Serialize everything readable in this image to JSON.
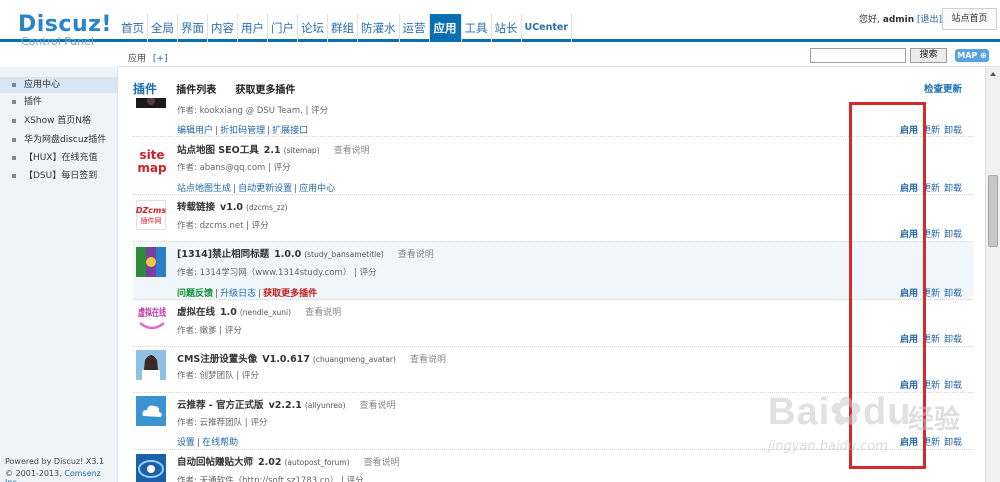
{
  "header": {
    "logo_brand": "Discuz!",
    "logo_sub": "Control Panel",
    "nav": [
      {
        "label": "首页"
      },
      {
        "label": "全局"
      },
      {
        "label": "界面"
      },
      {
        "label": "内容"
      },
      {
        "label": "用户"
      },
      {
        "label": "门户"
      },
      {
        "label": "论坛"
      },
      {
        "label": "群组"
      },
      {
        "label": "防灌水"
      },
      {
        "label": "运营"
      },
      {
        "label": "应用"
      },
      {
        "label": "工具"
      },
      {
        "label": "站长"
      },
      {
        "label": "UCenter"
      }
    ],
    "greeting": "您好,",
    "username": "admin",
    "logout": "[退出]",
    "site_home": "站点首页"
  },
  "subbar": {
    "crumb": "应用",
    "crumb_plus": "[+]",
    "search_value": "",
    "search_button": "搜索",
    "map_button": "MAP"
  },
  "sidebar": {
    "items": [
      {
        "label": "应用中心"
      },
      {
        "label": "插件"
      },
      {
        "label": "XShow 首页N格"
      },
      {
        "label": "华为网盘discuz插件"
      },
      {
        "label": "【HUX】在线充值"
      },
      {
        "label": "【DSU】每日签到"
      }
    ],
    "footer_powered": "Powered by",
    "footer_product": "Discuz! X3.1",
    "footer_copy": "© 2001-2013,",
    "footer_company": "Comsenz Inc."
  },
  "main": {
    "tab_title": "插件",
    "tab_list": "插件列表",
    "tab_more": "获取更多插件",
    "check_update": "检查更新",
    "actions": {
      "enable": "启用",
      "update": "更新",
      "uninstall": "卸载"
    },
    "plugins": [
      {
        "author": "作者: kookxiang @ DSU Team. | 评分",
        "links": [
          "编辑用户",
          "折扣码管理",
          "扩展接口"
        ]
      },
      {
        "name": "站点地图 SEO工具",
        "version": "2.1",
        "id": "(sitemap)",
        "doc": "查看说明",
        "author": "作者: abans@qq.com | 评分",
        "links": [
          "站点地图生成",
          "自动更新设置",
          "应用中心"
        ]
      },
      {
        "name": "转载链接",
        "version": "v1.0",
        "id": "(dzcms_zz)",
        "doc": "",
        "author": "作者: dzcms.net | 评分",
        "links": []
      },
      {
        "name": "[1314]禁止相同标题",
        "version": "1.0.0",
        "id": "(study_bansametitle)",
        "doc": "查看说明",
        "author": "作者: 1314学习网（www.1314study.com） | 评分",
        "links": [
          "问题反馈",
          "升级日志",
          "获取更多插件"
        ]
      },
      {
        "name": "虚拟在线",
        "version": "1.0",
        "id": "(nendie_xuni)",
        "doc": "查看说明",
        "author": "作者: 嫩爹 | 评分",
        "links": []
      },
      {
        "name": "CMS注册设置头像",
        "version": "V1.0.617",
        "id": "(chuangmeng_avatar)",
        "doc": "查看说明",
        "author": "作者: 创梦团队 | 评分",
        "links": []
      },
      {
        "name": "云推荐 - 官方正式版",
        "version": "v2.2.1",
        "id": "(allyunreo)",
        "doc": "查看说明",
        "author": "作者: 云推荐团队 | 评分",
        "links": [
          "设置",
          "在线帮助"
        ]
      },
      {
        "name": "自动回帖赚贴大师",
        "version": "2.02",
        "id": "(autopost_forum)",
        "doc": "查看说明",
        "author": "作者: 天通软件（http://soft.sz1783.cn） | 评分",
        "links": []
      }
    ],
    "thumb_text": {
      "sitemap_1": "site",
      "sitemap_2": "map",
      "dzcms_1": "DZcms",
      "dzcms_2": "插件网",
      "xuni": "虚拟在线"
    }
  },
  "watermark": {
    "brand": "Bai",
    "brand2": "du",
    "cn": "经验",
    "url": "jingyan.baidu.com"
  },
  "colors": {
    "accent": "#0a6eb3",
    "link": "#2366a8",
    "highlight_box": "#d62a2a",
    "green_link": "#109030",
    "red_link": "#c21a1a"
  }
}
